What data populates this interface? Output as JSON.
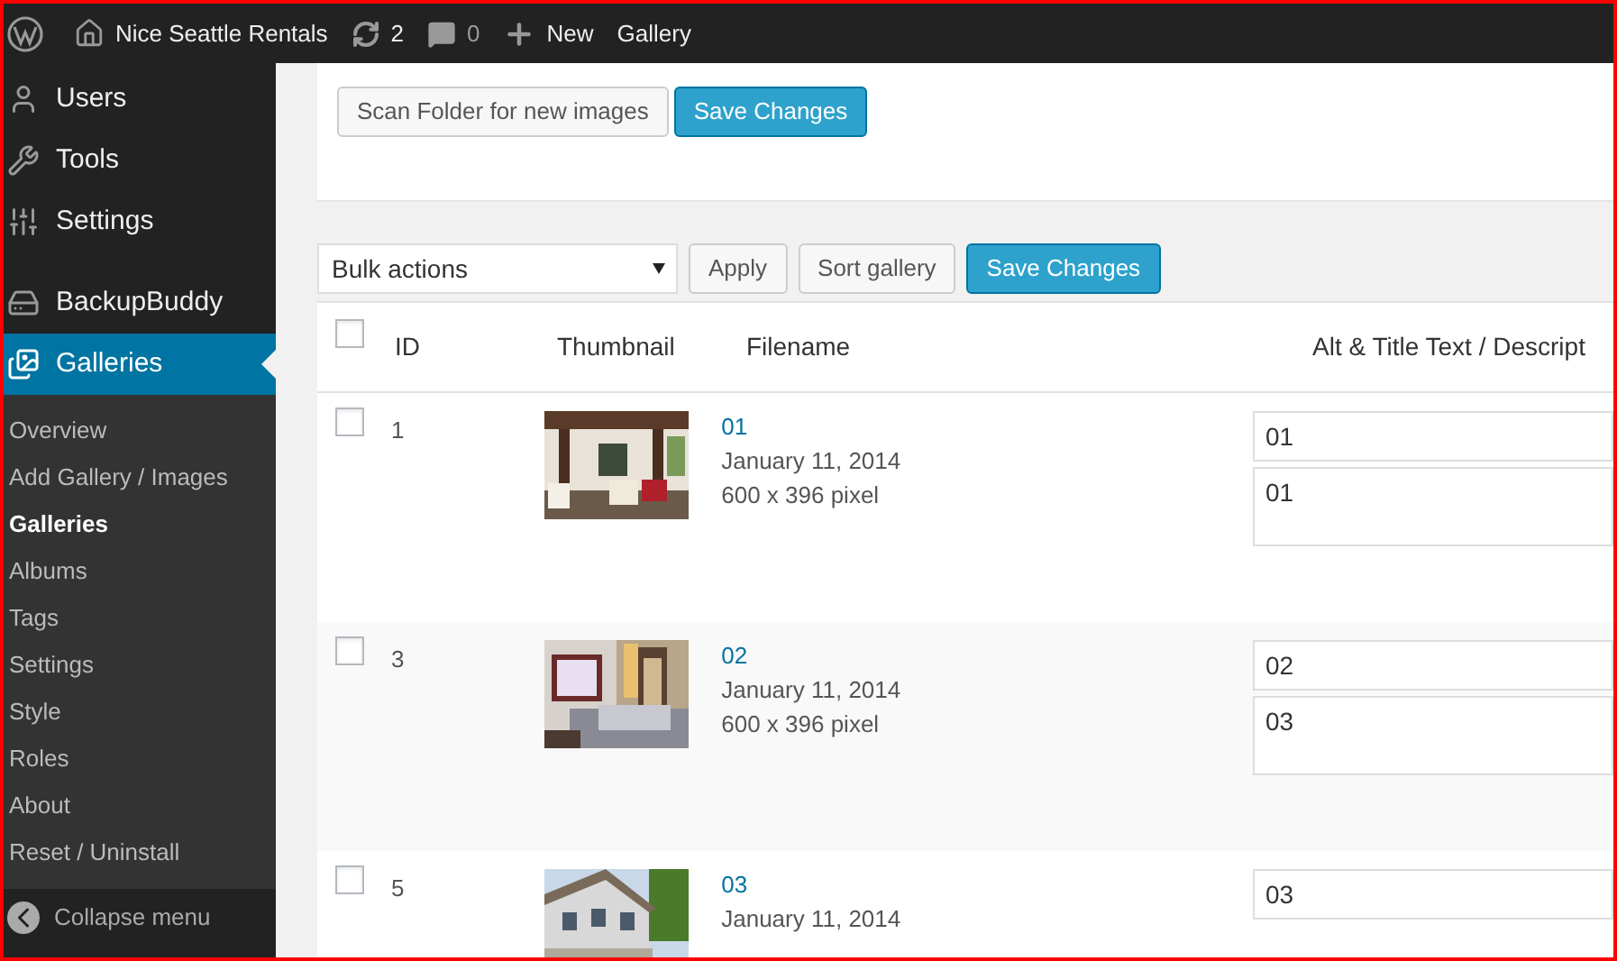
{
  "admin_bar": {
    "site_name": "Nice Seattle Rentals",
    "updates": "2",
    "comments": "0",
    "new_label": "New",
    "gallery_label": "Gallery"
  },
  "sidebar": {
    "groups": [
      {
        "items": [
          {
            "label": "Users",
            "kind": "users",
            "selected": false
          },
          {
            "label": "Tools",
            "kind": "tools",
            "selected": false
          },
          {
            "label": "Settings",
            "kind": "settings",
            "selected": false
          }
        ]
      },
      {
        "items": [
          {
            "label": "BackupBuddy",
            "kind": "backup",
            "selected": false
          },
          {
            "label": "Galleries",
            "kind": "galleries",
            "selected": true
          }
        ]
      }
    ],
    "submenu": [
      {
        "label": "Overview",
        "selected": false
      },
      {
        "label": "Add Gallery / Images",
        "selected": false
      },
      {
        "label": "Galleries",
        "selected": true
      },
      {
        "label": "Albums",
        "selected": false
      },
      {
        "label": "Tags",
        "selected": false
      },
      {
        "label": "Settings",
        "selected": false
      },
      {
        "label": "Style",
        "selected": false
      },
      {
        "label": "Roles",
        "selected": false
      },
      {
        "label": "About",
        "selected": false
      },
      {
        "label": "Reset / Uninstall",
        "selected": false
      }
    ],
    "collapse_label": "Collapse menu"
  },
  "top_panel": {
    "buttons": [
      {
        "label": "Scan Folder for new images",
        "kind": "secondary"
      },
      {
        "label": "Save Changes",
        "kind": "primary"
      }
    ]
  },
  "toolbar": {
    "bulk_select": "Bulk actions",
    "buttons": [
      {
        "label": "Apply",
        "kind": "secondary"
      },
      {
        "label": "Sort gallery",
        "kind": "secondary"
      },
      {
        "label": "Save Changes",
        "kind": "primary"
      }
    ]
  },
  "table": {
    "header_checked": false,
    "columns": [
      "ID",
      "Thumbnail",
      "Filename",
      "Alt & Title Text / Descript"
    ],
    "rows": [
      {
        "checked": false,
        "id": "1",
        "kind": "interior",
        "filename": "01",
        "date": "January 11, 2014",
        "size": "600 x 396 pixel",
        "alt": "01",
        "description": "01"
      },
      {
        "checked": false,
        "id": "3",
        "kind": "bedroom",
        "filename": "02",
        "date": "January 11, 2014",
        "size": "600 x 396 pixel",
        "alt": "02",
        "description": "03"
      },
      {
        "checked": false,
        "id": "5",
        "kind": "house",
        "filename": "03",
        "date": "January 11, 2014",
        "alt": "03"
      }
    ]
  }
}
